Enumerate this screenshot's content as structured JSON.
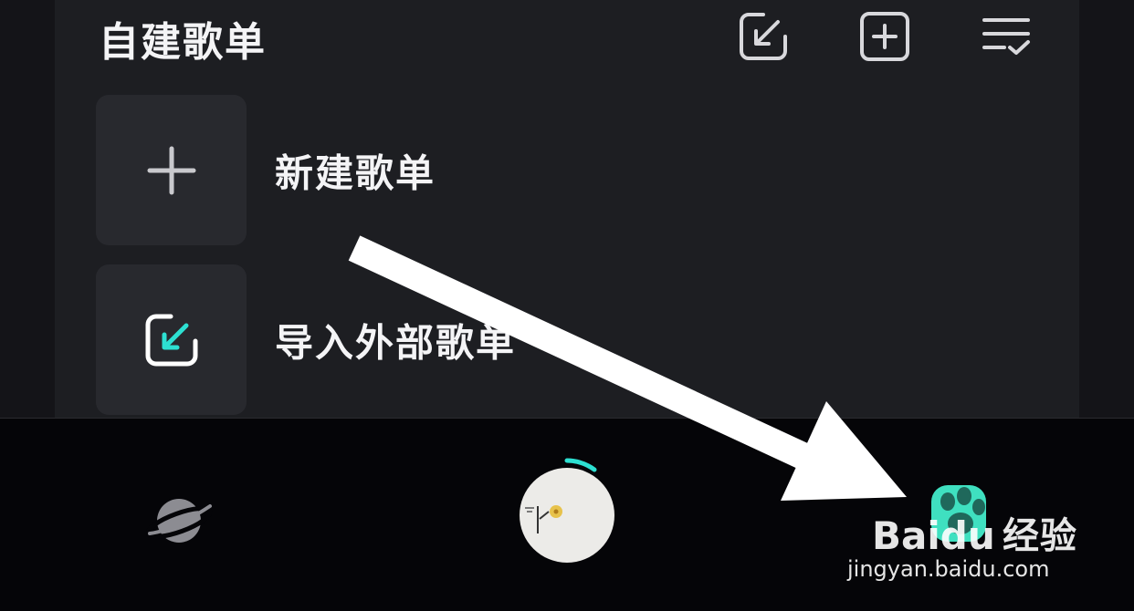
{
  "section": {
    "title": "自建歌单"
  },
  "header_icons": [
    {
      "name": "import-icon"
    },
    {
      "name": "add-square-icon"
    },
    {
      "name": "manage-list-icon"
    }
  ],
  "rows": [
    {
      "label": "新建歌单",
      "icon": "plus-icon"
    },
    {
      "label": "导入外部歌单",
      "icon": "import-icon",
      "accent": "#2de0d2"
    }
  ],
  "nav": {
    "items": [
      {
        "name": "discover-planet-icon"
      },
      {
        "name": "now-playing-disc"
      },
      {
        "name": "mine-tab"
      }
    ],
    "accent": "#2de0d2"
  },
  "watermark": {
    "brand": "经验",
    "logo_text": "Baidu",
    "url": "jingyan.baidu.com"
  }
}
